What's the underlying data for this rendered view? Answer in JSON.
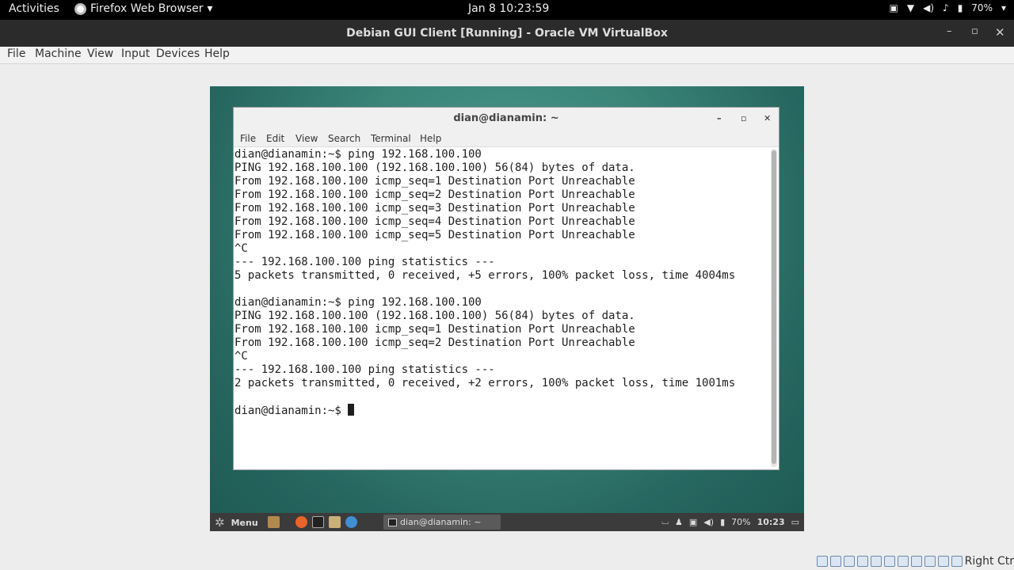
{
  "topbar": {
    "activities": "Activities",
    "app_menu": "Firefox Web Browser",
    "clock": "Jan 8  10:23:59",
    "battery": "70%"
  },
  "vbox": {
    "title": "Debian GUI Client [Running] - Oracle VM VirtualBox",
    "menu": [
      "File",
      "Machine",
      "View",
      "Input",
      "Devices",
      "Help"
    ],
    "host_key": "Right Ctr"
  },
  "terminal": {
    "title": "dian@dianamin: ~",
    "menu": [
      "File",
      "Edit",
      "View",
      "Search",
      "Terminal",
      "Help"
    ],
    "lines": [
      "dian@dianamin:~$ ping 192.168.100.100",
      "PING 192.168.100.100 (192.168.100.100) 56(84) bytes of data.",
      "From 192.168.100.100 icmp_seq=1 Destination Port Unreachable",
      "From 192.168.100.100 icmp_seq=2 Destination Port Unreachable",
      "From 192.168.100.100 icmp_seq=3 Destination Port Unreachable",
      "From 192.168.100.100 icmp_seq=4 Destination Port Unreachable",
      "From 192.168.100.100 icmp_seq=5 Destination Port Unreachable",
      "^C",
      "--- 192.168.100.100 ping statistics ---",
      "5 packets transmitted, 0 received, +5 errors, 100% packet loss, time 4004ms",
      "",
      "dian@dianamin:~$ ping 192.168.100.100",
      "PING 192.168.100.100 (192.168.100.100) 56(84) bytes of data.",
      "From 192.168.100.100 icmp_seq=1 Destination Port Unreachable",
      "From 192.168.100.100 icmp_seq=2 Destination Port Unreachable",
      "^C",
      "--- 192.168.100.100 ping statistics ---",
      "2 packets transmitted, 0 received, +2 errors, 100% packet loss, time 1001ms",
      "",
      "dian@dianamin:~$ "
    ]
  },
  "guest_panel": {
    "menu": "Menu",
    "task": "dian@dianamin: ~",
    "battery": "70%",
    "clock": "10:23"
  }
}
